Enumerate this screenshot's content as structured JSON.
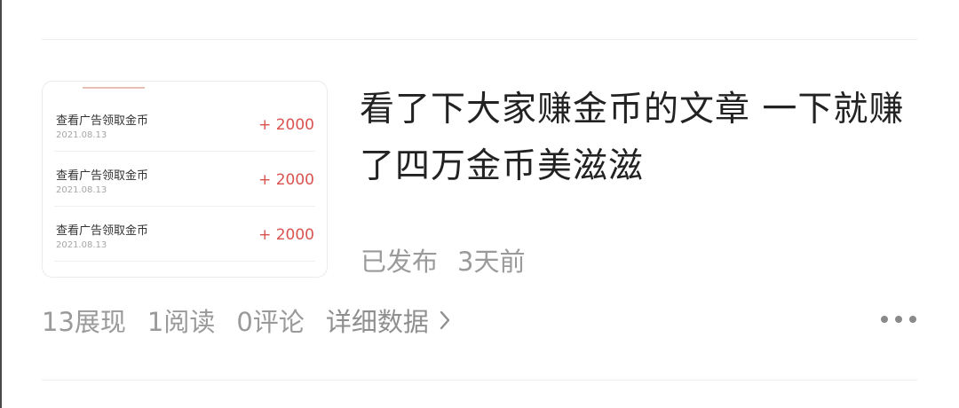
{
  "thumbnail": {
    "rows": [
      {
        "title": "查看广告领取金币",
        "date": "2021.08.13",
        "amount": "+ 2000"
      },
      {
        "title": "查看广告领取金币",
        "date": "2021.08.13",
        "amount": "+ 2000"
      },
      {
        "title": "查看广告领取金币",
        "date": "2021.08.13",
        "amount": "+ 2000"
      }
    ]
  },
  "article": {
    "title": "看了下大家赚金币的文章 一下就赚了四万金币美滋滋",
    "status": "已发布",
    "time": "3天前"
  },
  "stats": {
    "views": "13展现",
    "reads": "1阅读",
    "comments": "0评论",
    "detail_label": "详细数据"
  },
  "icons": {
    "detail": "chevron-right-icon",
    "more": "more-dots-icon"
  },
  "colors": {
    "amount": "#d9534f",
    "muted": "#9a9a9a",
    "title": "#222222"
  }
}
